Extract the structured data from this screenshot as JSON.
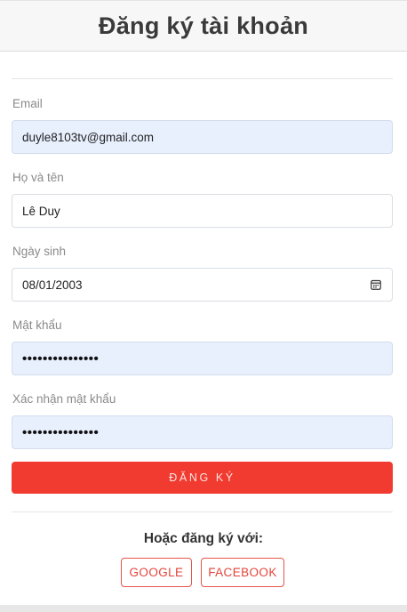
{
  "header": {
    "title": "Đăng ký tài khoản"
  },
  "form": {
    "email": {
      "label": "Email",
      "value": "duyle8103tv@gmail.com"
    },
    "fullname": {
      "label": "Họ và tên",
      "value": "Lê Duy"
    },
    "birthday": {
      "label": "Ngày sinh",
      "value": "08/01/2003",
      "icon": "calendar-icon"
    },
    "password": {
      "label": "Mật khẩu",
      "value": "•••••••••••••••"
    },
    "confirm_password": {
      "label": "Xác nhận mật khẩu",
      "value": "•••••••••••••••"
    },
    "submit_label": "ĐĂNG KÝ"
  },
  "social": {
    "heading": "Hoặc đăng ký với:",
    "google_label": "GOOGLE",
    "facebook_label": "FACEBOOK"
  },
  "colors": {
    "accent": "#f13b30",
    "autofill": "#e8f0fe",
    "social_border": "#e5554c"
  }
}
